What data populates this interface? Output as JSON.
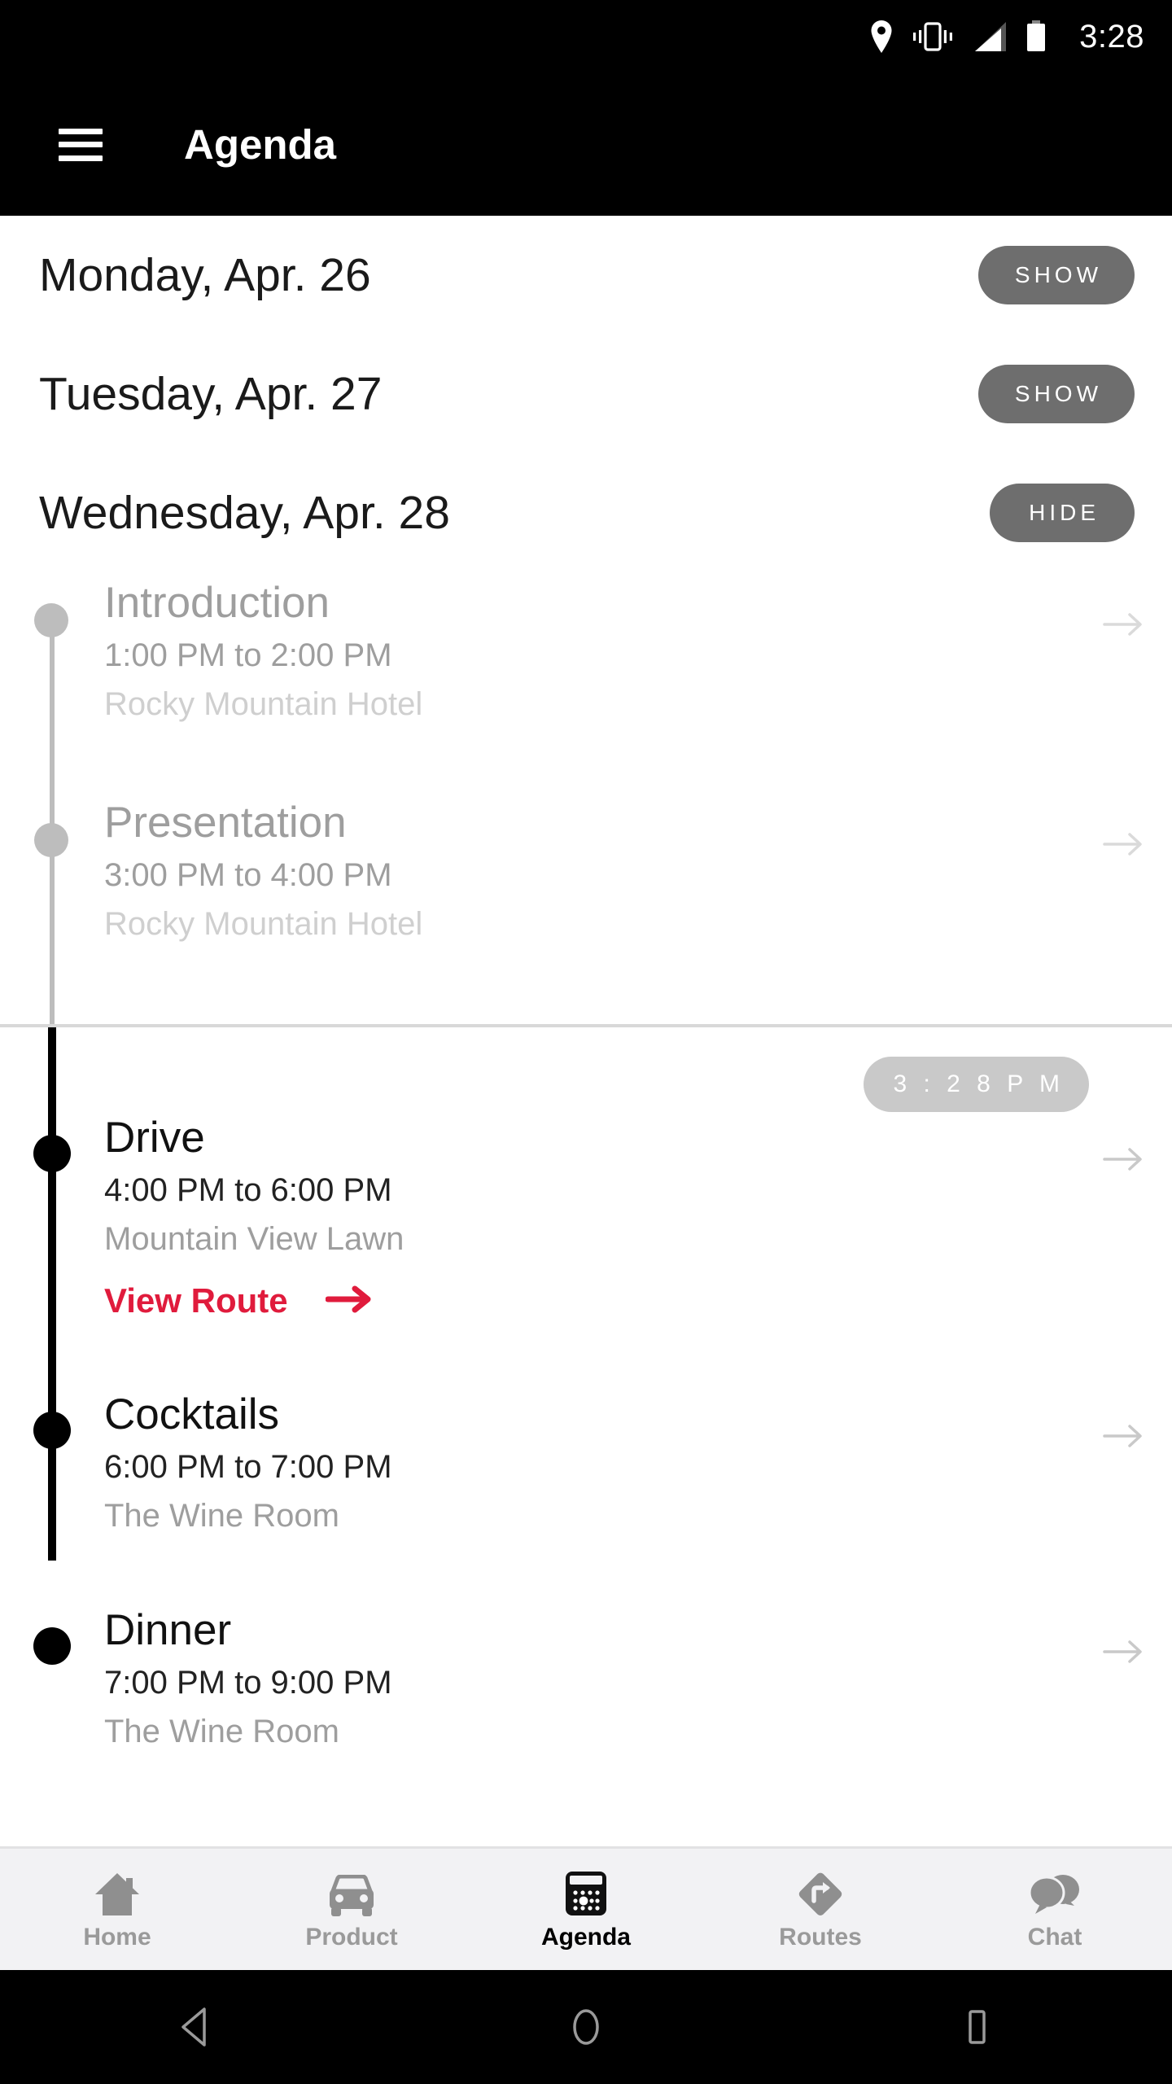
{
  "status_bar": {
    "time": "3:28",
    "icons": [
      "location-pin-icon",
      "vibrate-icon",
      "signal-icon",
      "battery-icon"
    ]
  },
  "app_bar": {
    "menu_icon": "hamburger-menu-icon",
    "title": "Agenda"
  },
  "days": [
    {
      "label": "Monday, Apr. 26",
      "toggle": "SHOW",
      "expanded": false
    },
    {
      "label": "Tuesday, Apr. 27",
      "toggle": "SHOW",
      "expanded": false
    },
    {
      "label": "Wednesday, Apr. 28",
      "toggle": "HIDE",
      "expanded": true
    }
  ],
  "past_events": [
    {
      "title": "Introduction",
      "time": "1:00 PM to 2:00 PM",
      "location": "Rocky Mountain Hotel",
      "chevron": "arrow-right-icon"
    },
    {
      "title": "Presentation",
      "time": "3:00 PM to 4:00 PM",
      "location": "Rocky Mountain Hotel",
      "chevron": "arrow-right-icon"
    }
  ],
  "now_marker": {
    "badge": "3 : 2 8   P M"
  },
  "future_events": [
    {
      "title": "Drive",
      "time": "4:00 PM to 6:00 PM",
      "location": "Mountain View Lawn",
      "chevron": "arrow-right-icon",
      "route_link": "View Route",
      "route_arrow": "arrow-right-icon"
    },
    {
      "title": "Cocktails",
      "time": "6:00 PM to 7:00 PM",
      "location": "The Wine Room",
      "chevron": "arrow-right-icon"
    },
    {
      "title": "Dinner",
      "time": "7:00 PM to 9:00 PM",
      "location": "The Wine Room",
      "chevron": "arrow-right-icon"
    }
  ],
  "tab_bar": {
    "tabs": [
      {
        "label": "Home",
        "icon": "home-icon",
        "active": false
      },
      {
        "label": "Product",
        "icon": "car-icon",
        "active": false
      },
      {
        "label": "Agenda",
        "icon": "calendar-icon",
        "active": true
      },
      {
        "label": "Routes",
        "icon": "route-sign-icon",
        "active": false
      },
      {
        "label": "Chat",
        "icon": "chat-bubbles-icon",
        "active": false
      }
    ]
  },
  "android_nav": {
    "back": "back-triangle-icon",
    "home": "home-circle-icon",
    "recents": "recents-square-icon"
  },
  "colors": {
    "accent_red": "#e01b3c",
    "app_bar_bg": "#000000",
    "pill_gray": "#6e6e6e",
    "now_badge_gray": "#c9c9c9"
  }
}
